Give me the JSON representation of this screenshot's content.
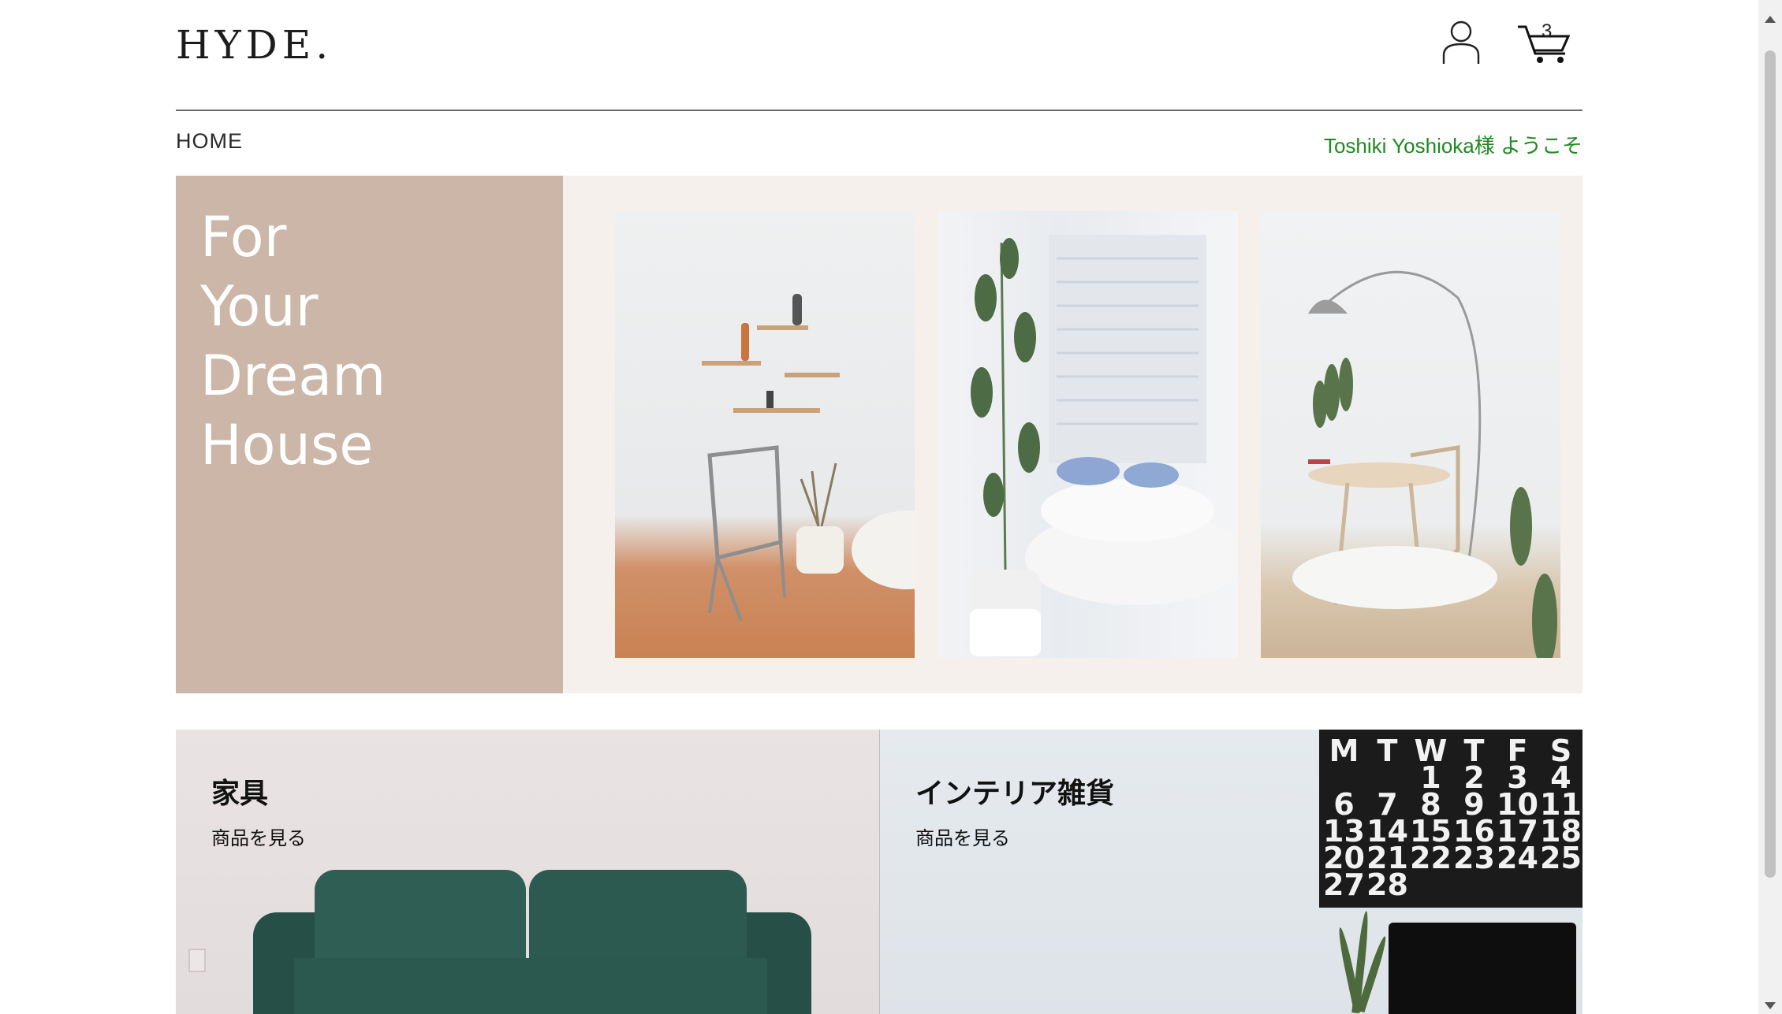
{
  "header": {
    "logo": "HYDE.",
    "cart_count": "3",
    "user_icon": "user-icon",
    "cart_icon": "cart-icon"
  },
  "nav": {
    "home": "HOME",
    "welcome": "Toshiki Yoshioka様 ようこそ"
  },
  "hero": {
    "title_lines": [
      "For",
      "Your",
      "Dream",
      "House"
    ],
    "title": "For\nYour\nDream\nHouse",
    "colors": {
      "left_panel": "#cbb6a8",
      "background": "#f5f0ec"
    }
  },
  "categories": [
    {
      "title": "家具",
      "link": "商品を見る"
    },
    {
      "title": "インテリア雑貨",
      "link": "商品を見る"
    }
  ],
  "calendar": {
    "days": [
      "M",
      "T",
      "W",
      "T",
      "F",
      "S"
    ],
    "dates": [
      "",
      "",
      "1",
      "2",
      "3",
      "4",
      "6",
      "7",
      "8",
      "9",
      "10",
      "11",
      "13",
      "14",
      "15",
      "16",
      "17",
      "18",
      "20",
      "21",
      "22",
      "23",
      "24",
      "25",
      "27",
      "28",
      "",
      "",
      "",
      ""
    ]
  },
  "colors": {
    "welcome_text": "#1f8a1f"
  }
}
